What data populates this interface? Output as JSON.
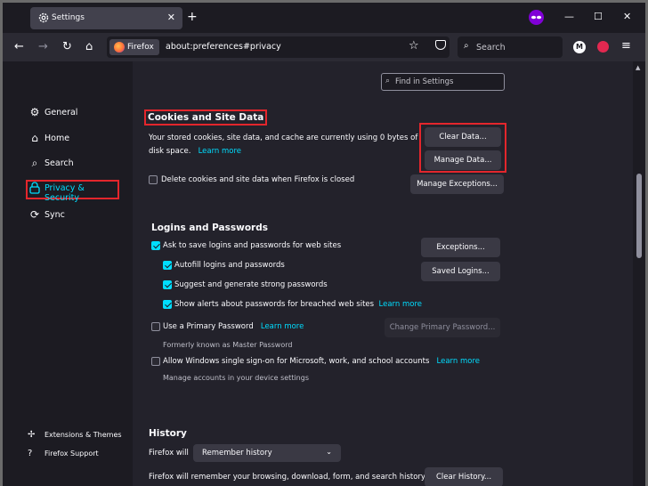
{
  "tab": {
    "title": "Settings",
    "close": "✕",
    "new_tab": "+"
  },
  "window_controls": {
    "minimize": "—",
    "maximize": "☐",
    "close": "✕"
  },
  "nav": {
    "back": "←",
    "forward": "→",
    "reload": "↻",
    "home": "⌂",
    "identity_label": "Firefox",
    "url": "about:preferences#privacy",
    "search_placeholder": "Search",
    "avatar_letter": "M",
    "menu": "≡"
  },
  "sidebar": {
    "items": [
      {
        "label": "General",
        "icon": "gear-icon",
        "glyph": "⚙"
      },
      {
        "label": "Home",
        "icon": "home-icon",
        "glyph": "⌂"
      },
      {
        "label": "Search",
        "icon": "search-icon",
        "glyph": "⌕"
      },
      {
        "label": "Privacy & Security",
        "icon": "lock-icon",
        "glyph": "🔒"
      },
      {
        "label": "Sync",
        "icon": "sync-icon",
        "glyph": "⟳"
      }
    ],
    "footer": [
      {
        "label": "Extensions & Themes",
        "icon": "puzzle-icon",
        "glyph": "✢"
      },
      {
        "label": "Firefox Support",
        "icon": "help-icon",
        "glyph": "?"
      }
    ]
  },
  "find_placeholder": "Find in Settings",
  "cookies": {
    "heading": "Cookies and Site Data",
    "desc_line1": "Your stored cookies, site data, and cache are currently using 0 bytes of",
    "desc_line2": "disk space.",
    "learn_more": "Learn more",
    "clear_data": "Clear Data...",
    "manage_data": "Manage Data...",
    "delete_on_close": "Delete cookies and site data when Firefox is closed",
    "delete_on_close_checked": false,
    "manage_exceptions": "Manage Exceptions..."
  },
  "logins": {
    "heading": "Logins and Passwords",
    "ask_save": "Ask to save logins and passwords for web sites",
    "ask_save_checked": true,
    "autofill": "Autofill logins and passwords",
    "autofill_checked": true,
    "suggest": "Suggest and generate strong passwords",
    "suggest_checked": true,
    "alerts": "Show alerts about passwords for breached web sites",
    "alerts_checked": true,
    "alerts_learn_more": "Learn more",
    "exceptions": "Exceptions...",
    "saved_logins": "Saved Logins...",
    "primary_pw": "Use a Primary Password",
    "primary_pw_checked": false,
    "primary_learn_more": "Learn more",
    "change_primary": "Change Primary Password...",
    "formerly": "Formerly known as Master Password",
    "sso": "Allow Windows single sign-on for Microsoft, work, and school accounts",
    "sso_checked": false,
    "sso_learn_more": "Learn more",
    "sso_sub": "Manage accounts in your device settings"
  },
  "history": {
    "heading": "History",
    "firefox_will": "Firefox will",
    "select_value": "Remember history",
    "desc": "Firefox will remember your browsing, download, form, and search history.",
    "clear_history": "Clear History..."
  },
  "colors": {
    "accent": "#00ddff",
    "highlight": "#e3262c",
    "bg": "#23222b"
  }
}
